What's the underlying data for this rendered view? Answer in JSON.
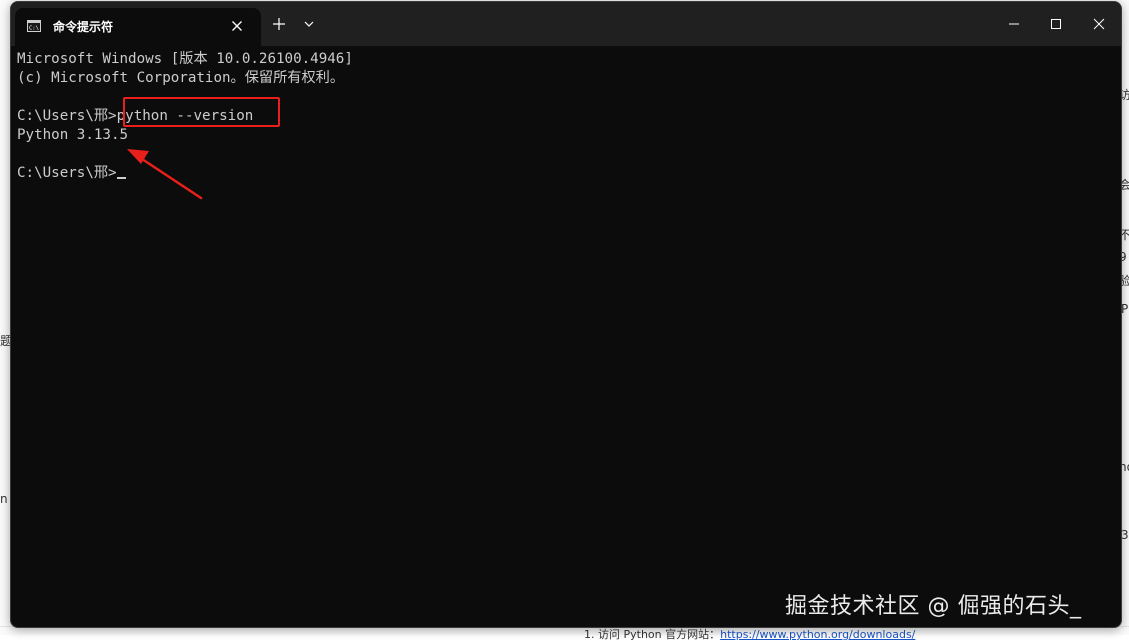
{
  "window": {
    "tab_title": "命令提示符",
    "icon": "cmd-icon"
  },
  "terminal": {
    "lines": [
      "Microsoft Windows [版本 10.0.26100.4946]",
      "(c) Microsoft Corporation。保留所有权利。",
      "",
      "C:\\Users\\邢>",
      "Python 3.13.5",
      "",
      "C:\\Users\\邢>"
    ],
    "command": "python --version"
  },
  "annotation": {
    "color": "#e8201b"
  },
  "watermark": "掘金技术社区 @ 倔强的石头_",
  "background": {
    "fragments": [
      "访",
      "会",
      "不",
      "9",
      "验",
      "P",
      "题",
      "n",
      "ho",
      "3"
    ],
    "footer_prefix": "1. 访问 Python 官方网站：",
    "footer_link": "https://www.python.org/downloads/"
  }
}
